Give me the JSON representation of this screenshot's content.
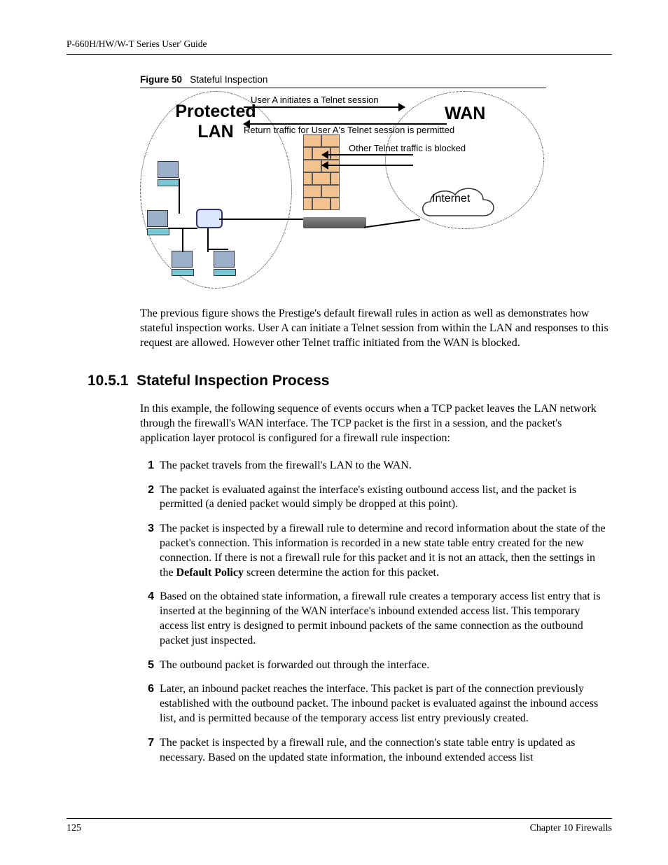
{
  "header": {
    "title": "P-660H/HW/W-T Series User' Guide"
  },
  "figure": {
    "label": "Figure 50",
    "caption": "Stateful Inspection",
    "labels": {
      "protected_lan": "Protected LAN",
      "wan": "WAN",
      "internet": "Internet",
      "line1": "User A initiates a Telnet session",
      "line2": "Return traffic for User A's Telnet session is permitted",
      "line3": "Other Telnet traffic is blocked"
    }
  },
  "para_after_figure": "The previous figure shows the Prestige's default firewall rules in action as well as demonstrates how stateful inspection works. User A can initiate a Telnet session from within the LAN and responses to this request are allowed. However other Telnet traffic initiated from the WAN is blocked.",
  "section": {
    "number": "10.5.1",
    "title": "Stateful Inspection Process"
  },
  "intro_para": "In this example, the following sequence of events occurs when a TCP packet leaves the LAN network through the firewall's WAN interface. The TCP packet is the first in a session, and the packet's application layer protocol is configured for a firewall rule inspection:",
  "steps": [
    {
      "n": "1",
      "text": "The packet travels from the firewall's LAN to the WAN."
    },
    {
      "n": "2",
      "text": "The packet is evaluated against the interface's existing outbound access list, and the packet is permitted (a denied packet would simply be dropped at this point)."
    },
    {
      "n": "3",
      "text_before": "The packet is inspected by a firewall rule to determine and record information about the state of the packet's connection. This information is recorded in a new state table entry created for the new connection. If there is not a firewall rule for this packet and it is not an attack, then the settings in the  ",
      "bold": "Default Policy",
      "text_after": " screen determine the action for this packet."
    },
    {
      "n": "4",
      "text": "Based on the obtained state information, a firewall rule creates a temporary access list entry that is inserted at the beginning of the WAN interface's inbound extended access list. This temporary access list entry is designed to permit inbound packets of the same connection as the outbound packet just inspected."
    },
    {
      "n": "5",
      "text": "The outbound packet is forwarded out through the interface."
    },
    {
      "n": "6",
      "text": "Later, an inbound packet reaches the interface. This packet is part of the connection previously established with the outbound packet. The inbound packet is evaluated against the inbound access list, and is permitted because of the temporary access list entry previously created."
    },
    {
      "n": "7",
      "text": "The packet is inspected by a firewall rule, and the connection's state table entry is updated as necessary. Based on the updated state information, the inbound extended access list"
    }
  ],
  "footer": {
    "page": "125",
    "chapter": "Chapter 10 Firewalls"
  }
}
